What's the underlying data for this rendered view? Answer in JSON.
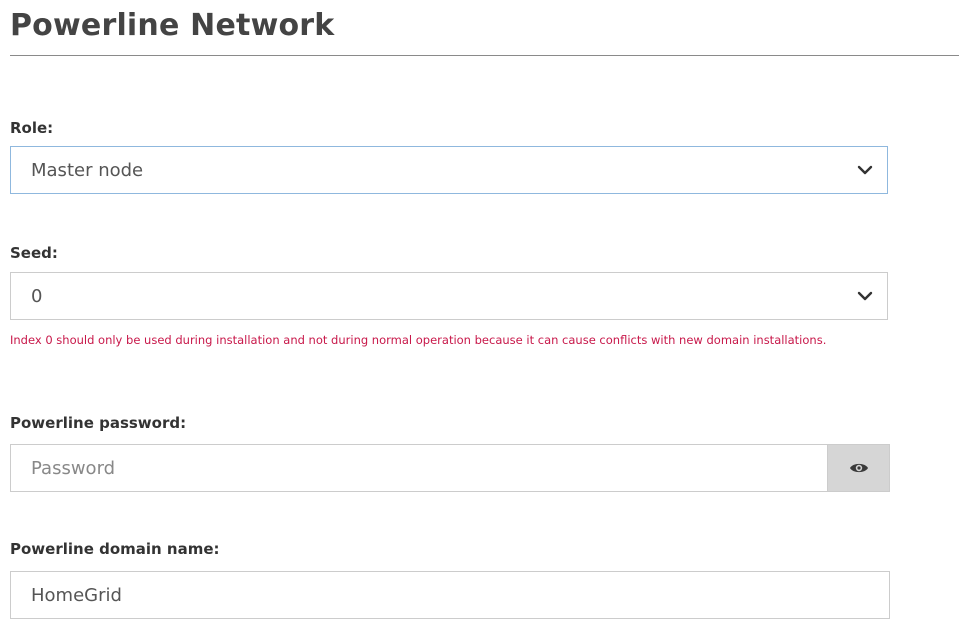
{
  "page": {
    "title": "Powerline Network"
  },
  "role": {
    "label": "Role:",
    "value": "Master node"
  },
  "seed": {
    "label": "Seed:",
    "value": "0",
    "hint": "Index 0 should only be used during installation and not during normal operation because it can cause conflicts with new domain installations."
  },
  "password": {
    "label": "Powerline password:",
    "placeholder": "Password",
    "value": ""
  },
  "domain_name": {
    "label": "Powerline domain name:",
    "value": "HomeGrid"
  },
  "icons": {
    "dropdown": "chevron-down-icon",
    "reveal": "eye-icon"
  },
  "colors": {
    "hint": "#c8184a",
    "focus_border": "#8fb8de",
    "eye_button_bg": "#d6d6d6"
  }
}
